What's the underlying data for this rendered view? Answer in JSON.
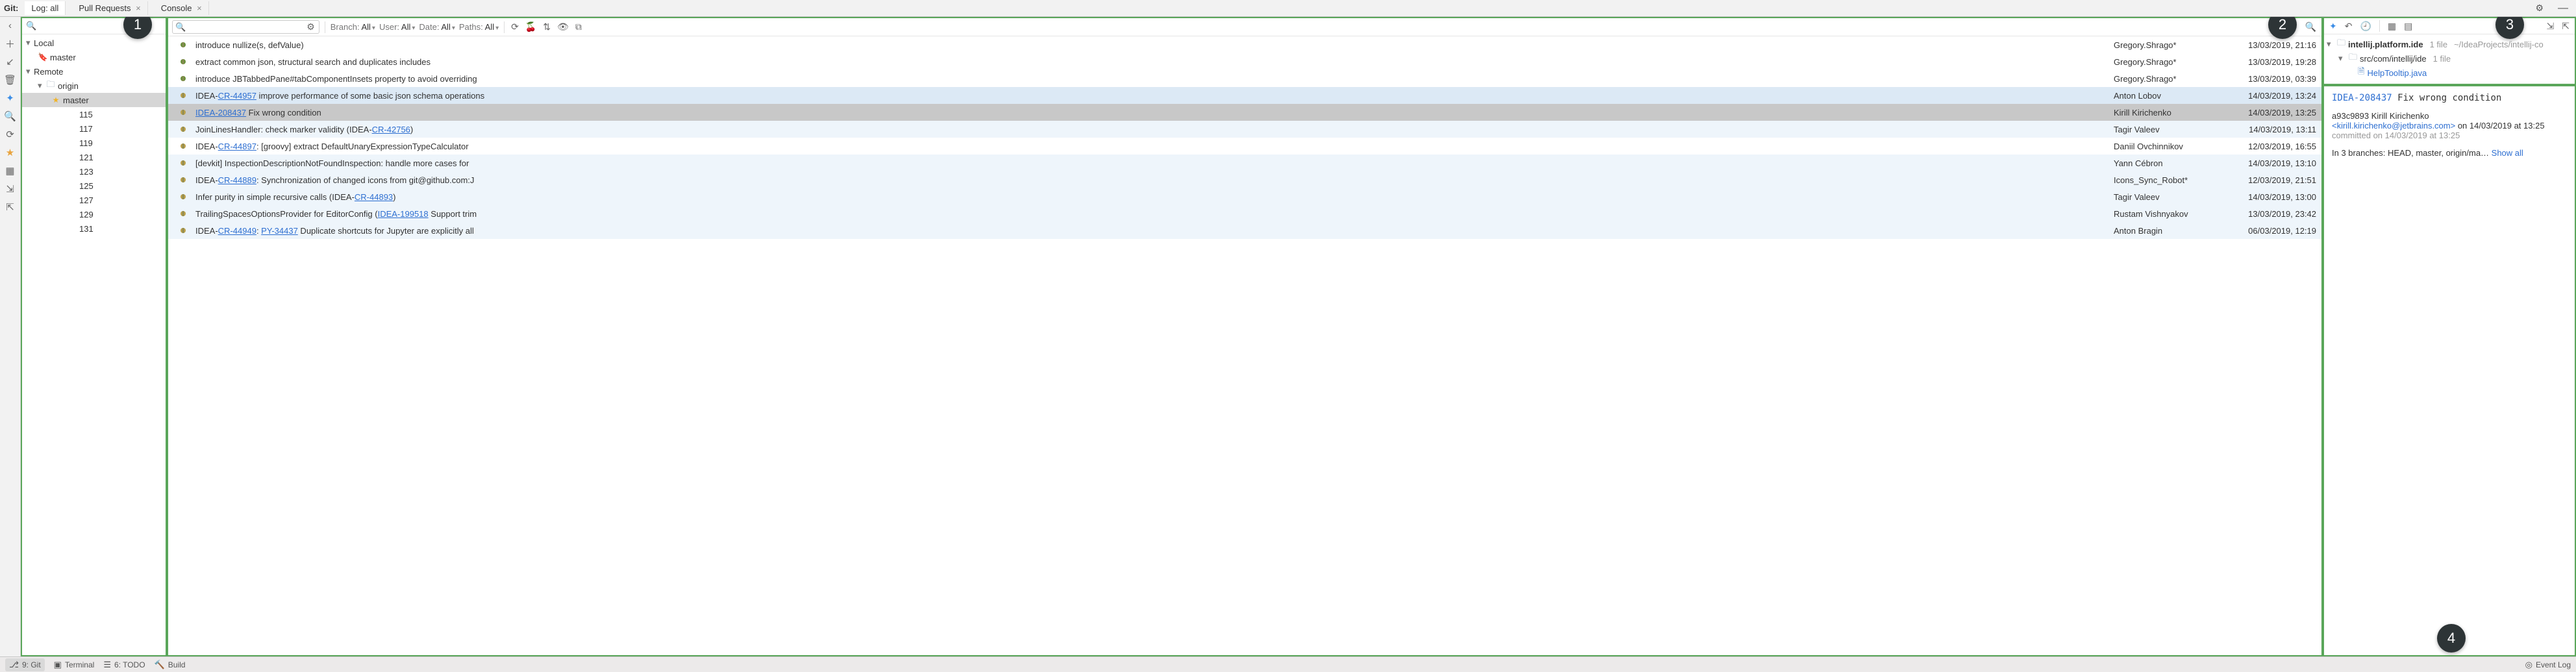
{
  "tabs": {
    "label_git": "Git:",
    "log": "Log: all",
    "pull": "Pull Requests",
    "console": "Console"
  },
  "callouts": {
    "one": "1",
    "two": "2",
    "three": "3",
    "four": "4"
  },
  "branches": {
    "local_header": "Local",
    "master": "master",
    "remote_header": "Remote",
    "origin": "origin",
    "origin_master": "master",
    "nums": [
      "115",
      "117",
      "119",
      "121",
      "123",
      "125",
      "127",
      "129",
      "131"
    ]
  },
  "filters": {
    "branch_lbl": "Branch:",
    "branch_val": "All",
    "user_lbl": "User:",
    "user_val": "All",
    "date_lbl": "Date:",
    "date_val": "All",
    "paths_lbl": "Paths:",
    "paths_val": "All"
  },
  "commits": [
    {
      "msg_pre": "introduce nullize(s, defValue)",
      "author": "Gregory.Shrago*",
      "date": "13/03/2019, 21:16",
      "hl": ""
    },
    {
      "msg_pre": "extract common json, structural search and duplicates includes",
      "author": "Gregory.Shrago*",
      "date": "13/03/2019, 19:28",
      "hl": ""
    },
    {
      "msg_pre": "introduce JBTabbedPane#tabComponentInsets property to avoid overriding",
      "author": "Gregory.Shrago*",
      "date": "13/03/2019, 03:39",
      "hl": ""
    },
    {
      "msg_pre": "IDEA-",
      "link": "CR-44957",
      "msg_post": " improve performance of some basic json schema operations",
      "author": "Anton Lobov",
      "date": "14/03/2019, 13:24",
      "hl": "blue"
    },
    {
      "msg_pre": "",
      "link": "IDEA-208437",
      "msg_post": " Fix wrong condition",
      "author": "Kirill Kirichenko",
      "date": "14/03/2019, 13:25",
      "hl": "sel"
    },
    {
      "msg_pre": "JoinLinesHandler: check marker validity (IDEA-",
      "link": "CR-42756",
      "msg_post": ")",
      "author": "Tagir Valeev",
      "date": "14/03/2019, 13:11",
      "hl": "light"
    },
    {
      "msg_pre": "IDEA-",
      "link": "CR-44897",
      "msg_post": ": [groovy] extract DefaultUnaryExpressionTypeCalculator",
      "author": "Daniil Ovchinnikov",
      "date": "12/03/2019, 16:55",
      "hl": ""
    },
    {
      "msg_pre": "[devkit] InspectionDescriptionNotFoundInspection: handle more cases for",
      "author": "Yann Cébron",
      "date": "14/03/2019, 13:10",
      "hl": "light"
    },
    {
      "msg_pre": "IDEA-",
      "link": "CR-44889",
      "msg_post": ": Synchronization of changed icons from git@github.com:J",
      "author": "Icons_Sync_Robot*",
      "date": "12/03/2019, 21:51",
      "hl": "light"
    },
    {
      "msg_pre": "Infer purity in simple recursive calls (IDEA-",
      "link": "CR-44893",
      "msg_post": ")",
      "author": "Tagir Valeev",
      "date": "14/03/2019, 13:00",
      "hl": "light"
    },
    {
      "msg_pre": "TrailingSpacesOptionsProvider for EditorConfig (",
      "link": "IDEA-199518",
      "msg_post": " Support trim",
      "author": "Rustam Vishnyakov",
      "date": "13/03/2019, 23:42",
      "hl": "light"
    },
    {
      "msg_pre": "IDEA-",
      "link": "CR-44949",
      "msg_post_pre": ": ",
      "link2": "PY-34437",
      "msg_post": " Duplicate shortcuts for Jupyter are explicitly all",
      "author": "Anton Bragin",
      "date": "06/03/2019, 12:19",
      "hl": "light"
    }
  ],
  "files": {
    "root": "intellij.platform.ide",
    "root_count": "1 file",
    "root_path": "~/IdeaProjects/intellij-co",
    "sub": "src/com/intellij/ide",
    "sub_count": "1 file",
    "file": "HelpTooltip.java"
  },
  "details": {
    "issue": "IDEA-208437",
    "subject": "Fix wrong condition",
    "hash": "a93c9893",
    "author": "Kirill Kirichenko",
    "email": "<kirill.kirichenko@jetbrains.com>",
    "on": " on 14/03/2019 at 13:25",
    "committed": "committed on 14/03/2019 at 13:25",
    "branches_pre": "In 3 branches: HEAD, master, origin/ma… ",
    "showall": "Show all"
  },
  "status": {
    "git": "9: Git",
    "terminal": "Terminal",
    "todo": "6: TODO",
    "build": "Build",
    "eventlog": "Event Log"
  }
}
